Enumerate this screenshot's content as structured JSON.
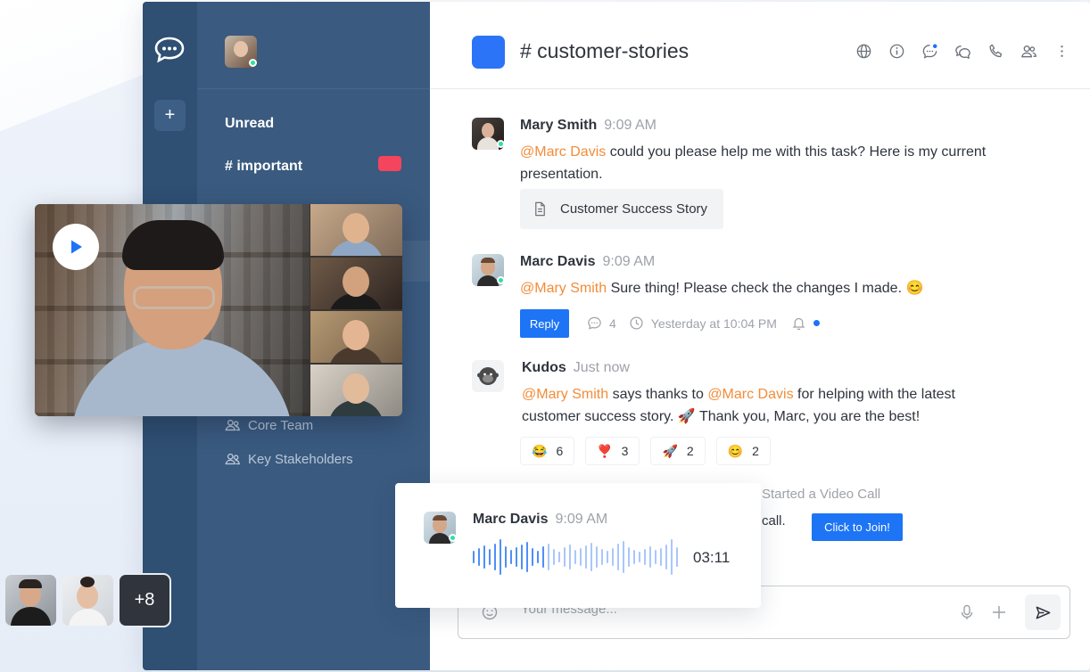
{
  "sidebar": {
    "unread_label": "Unread",
    "important_label": "# important",
    "teams": [
      {
        "label": "Core Team"
      },
      {
        "label": "Key Stakeholders"
      }
    ]
  },
  "room": {
    "title": "# customer-stories"
  },
  "messages": [
    {
      "author": "Mary Smith",
      "time": "9:09 AM",
      "mention": "@Marc Davis",
      "text_line1": " could you please help me with this task? Here is my current",
      "text_line2": "presentation.",
      "attachment": "Customer Success Story"
    },
    {
      "author": "Marc Davis",
      "time": "9:09 AM",
      "mention": "@Mary Smith",
      "text": " Sure thing! Please check the changes I made. 😊",
      "reply_label": "Reply",
      "thread_count": "4",
      "thread_time": "Yesterday at 10:04 PM"
    },
    {
      "author": "Kudos",
      "time": "Just now",
      "mention1": "@Mary Smith",
      "text_a": " says thanks to ",
      "mention2": "@Marc Davis",
      "text_b": " for helping with the latest",
      "text_line2": "customer success story. 🚀 Thank you, Marc, you are the best!",
      "reactions": [
        {
          "emoji": "😂",
          "count": "6"
        },
        {
          "emoji": "❣️",
          "count": "3"
        },
        {
          "emoji": "🚀",
          "count": "2"
        },
        {
          "emoji": "😊",
          "count": "2"
        }
      ]
    }
  ],
  "video_call": {
    "started_text": "Started a Video Call",
    "call_text": "call.",
    "join_label": "Click to Join!"
  },
  "voice_message": {
    "author": "Marc Davis",
    "time": "9:09 AM",
    "duration": "03:11"
  },
  "composer": {
    "placeholder": "Your message..."
  },
  "participants": {
    "more_label": "+8"
  },
  "colors": {
    "rail": "#2f4f73",
    "sidebar": "#3a5a7f",
    "accent": "#1d74f5",
    "mention": "#f38c39",
    "important_badge": "#f5455c",
    "online": "#2de0a5"
  }
}
